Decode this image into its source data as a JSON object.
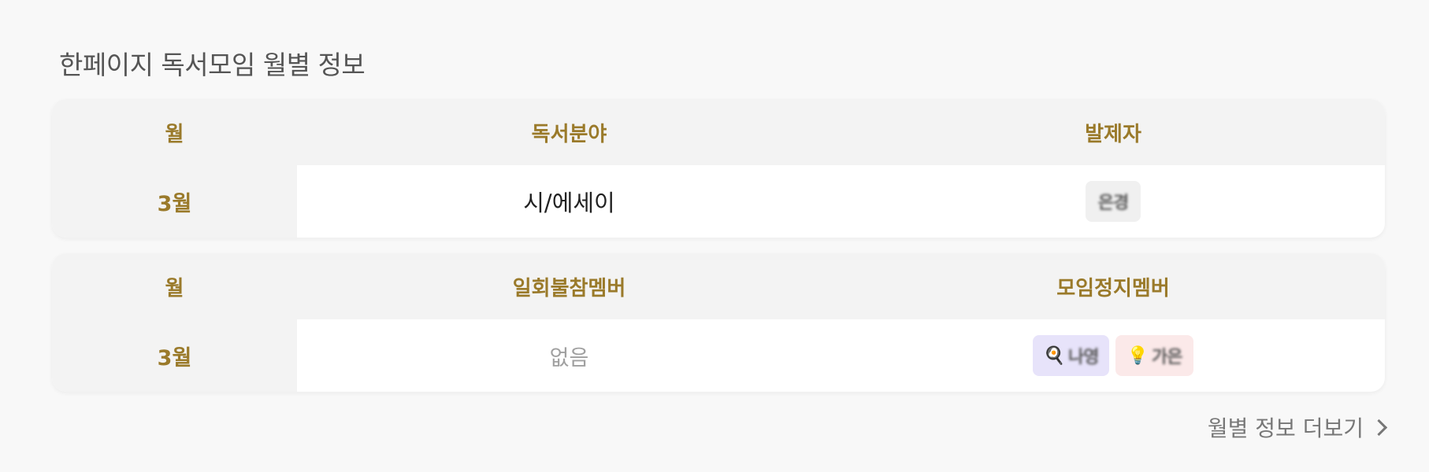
{
  "section": {
    "title": "한페이지 독서모임 월별 정보"
  },
  "table1": {
    "headers": [
      "월",
      "독서분야",
      "발제자"
    ],
    "row": {
      "month": "3월",
      "genre": "시/에세이",
      "presenter": "은경"
    }
  },
  "table2": {
    "headers": [
      "월",
      "일회불참멤버",
      "모임정지멤버"
    ],
    "row": {
      "month": "3월",
      "absent": "없음",
      "suspended": [
        {
          "emoji": "🍳",
          "name": "나영",
          "color": "#e7e3fa"
        },
        {
          "emoji": "💡",
          "name": "가은",
          "color": "#fbe9e9"
        }
      ]
    }
  },
  "footer": {
    "more_label": "월별 정보 더보기"
  },
  "colors": {
    "accent": "#9a7a2a",
    "header_bg": "#f3f3f3",
    "page_bg": "#f8f8f8"
  }
}
